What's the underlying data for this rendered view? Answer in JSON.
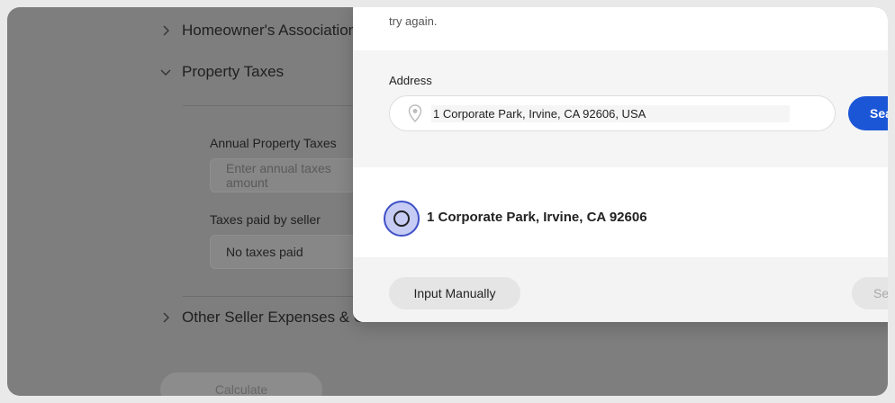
{
  "background_page": {
    "sections": [
      {
        "label": "Homeowner's Association",
        "expanded": false
      },
      {
        "label": "Property Taxes",
        "expanded": true
      },
      {
        "label": "Other Seller Expenses & Credits",
        "expanded": false
      }
    ],
    "annual_taxes": {
      "label": "Annual Property Taxes",
      "placeholder": "Enter annual taxes amount"
    },
    "taxes_paid": {
      "label": "Taxes paid by seller",
      "value": "No taxes paid"
    },
    "calculate_label": "Calculate"
  },
  "modal": {
    "message": "try again.",
    "address": {
      "label": "Address",
      "value": "1 Corporate Park, Irvine, CA 92606, USA",
      "search_label": "Search"
    },
    "result": {
      "text": "1 Corporate Park, Irvine, CA 92606",
      "selected": false
    },
    "footer": {
      "manual_label": "Input Manually",
      "select_label": "Select"
    }
  },
  "colors": {
    "accent": "#1b56d6",
    "focus_ring": "#3f51c7"
  }
}
